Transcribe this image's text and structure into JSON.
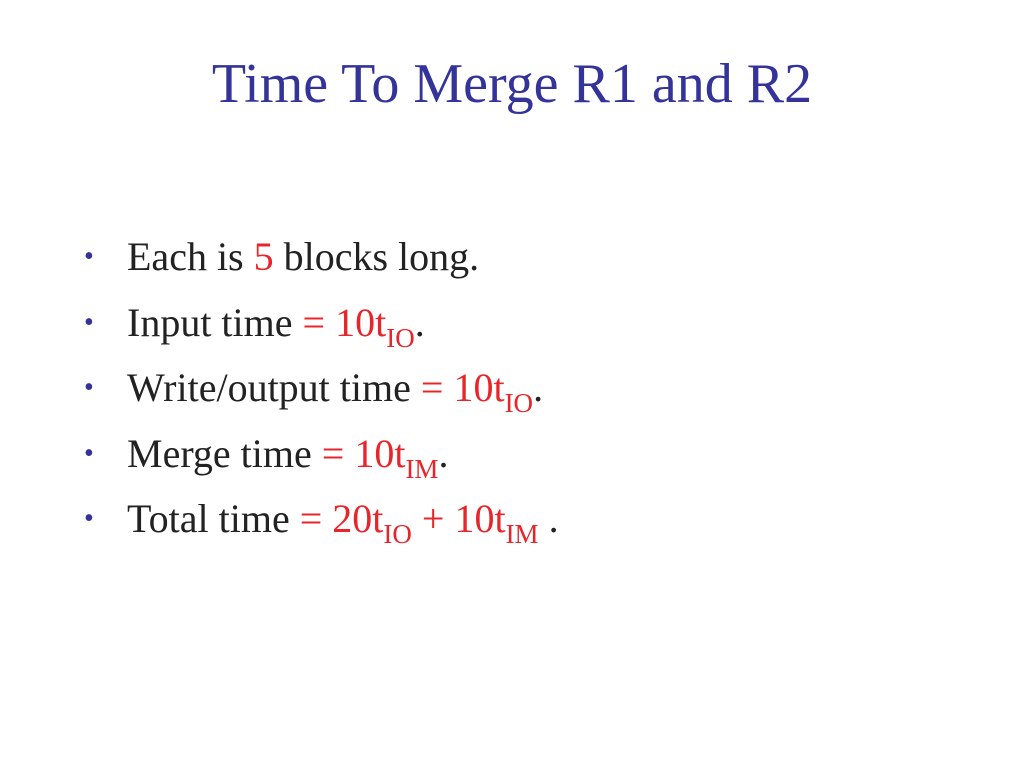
{
  "slide": {
    "title": "Time To Merge R1 and R2",
    "bullet_glyph": "•",
    "bullets": [
      {
        "parts": [
          {
            "text": "Each is ",
            "style": "normal"
          },
          {
            "text": "5",
            "style": "red"
          },
          {
            "text": " blocks long.",
            "style": "normal"
          }
        ]
      },
      {
        "parts": [
          {
            "text": "Input time ",
            "style": "normal"
          },
          {
            "text": "= 10t",
            "style": "red"
          },
          {
            "text": "IO",
            "style": "red-sub"
          },
          {
            "text": ".",
            "style": "normal"
          }
        ]
      },
      {
        "parts": [
          {
            "text": "Write/output time ",
            "style": "normal"
          },
          {
            "text": "= 10t",
            "style": "red"
          },
          {
            "text": "IO",
            "style": "red-sub"
          },
          {
            "text": ".",
            "style": "normal"
          }
        ]
      },
      {
        "parts": [
          {
            "text": "Merge time ",
            "style": "normal"
          },
          {
            "text": "= 10t",
            "style": "red"
          },
          {
            "text": "IM",
            "style": "red-sub"
          },
          {
            "text": ".",
            "style": "normal"
          }
        ]
      },
      {
        "parts": [
          {
            "text": "Total time ",
            "style": "normal"
          },
          {
            "text": "= 20t",
            "style": "red"
          },
          {
            "text": "IO",
            "style": "red-sub"
          },
          {
            "text": " + 10t",
            "style": "red"
          },
          {
            "text": "IM",
            "style": "red-sub"
          },
          {
            "text": " .",
            "style": "normal"
          }
        ]
      }
    ]
  },
  "colors": {
    "title": "#333399",
    "bullet": "#333399",
    "body_text": "#222222",
    "highlight": "#e8252a"
  }
}
